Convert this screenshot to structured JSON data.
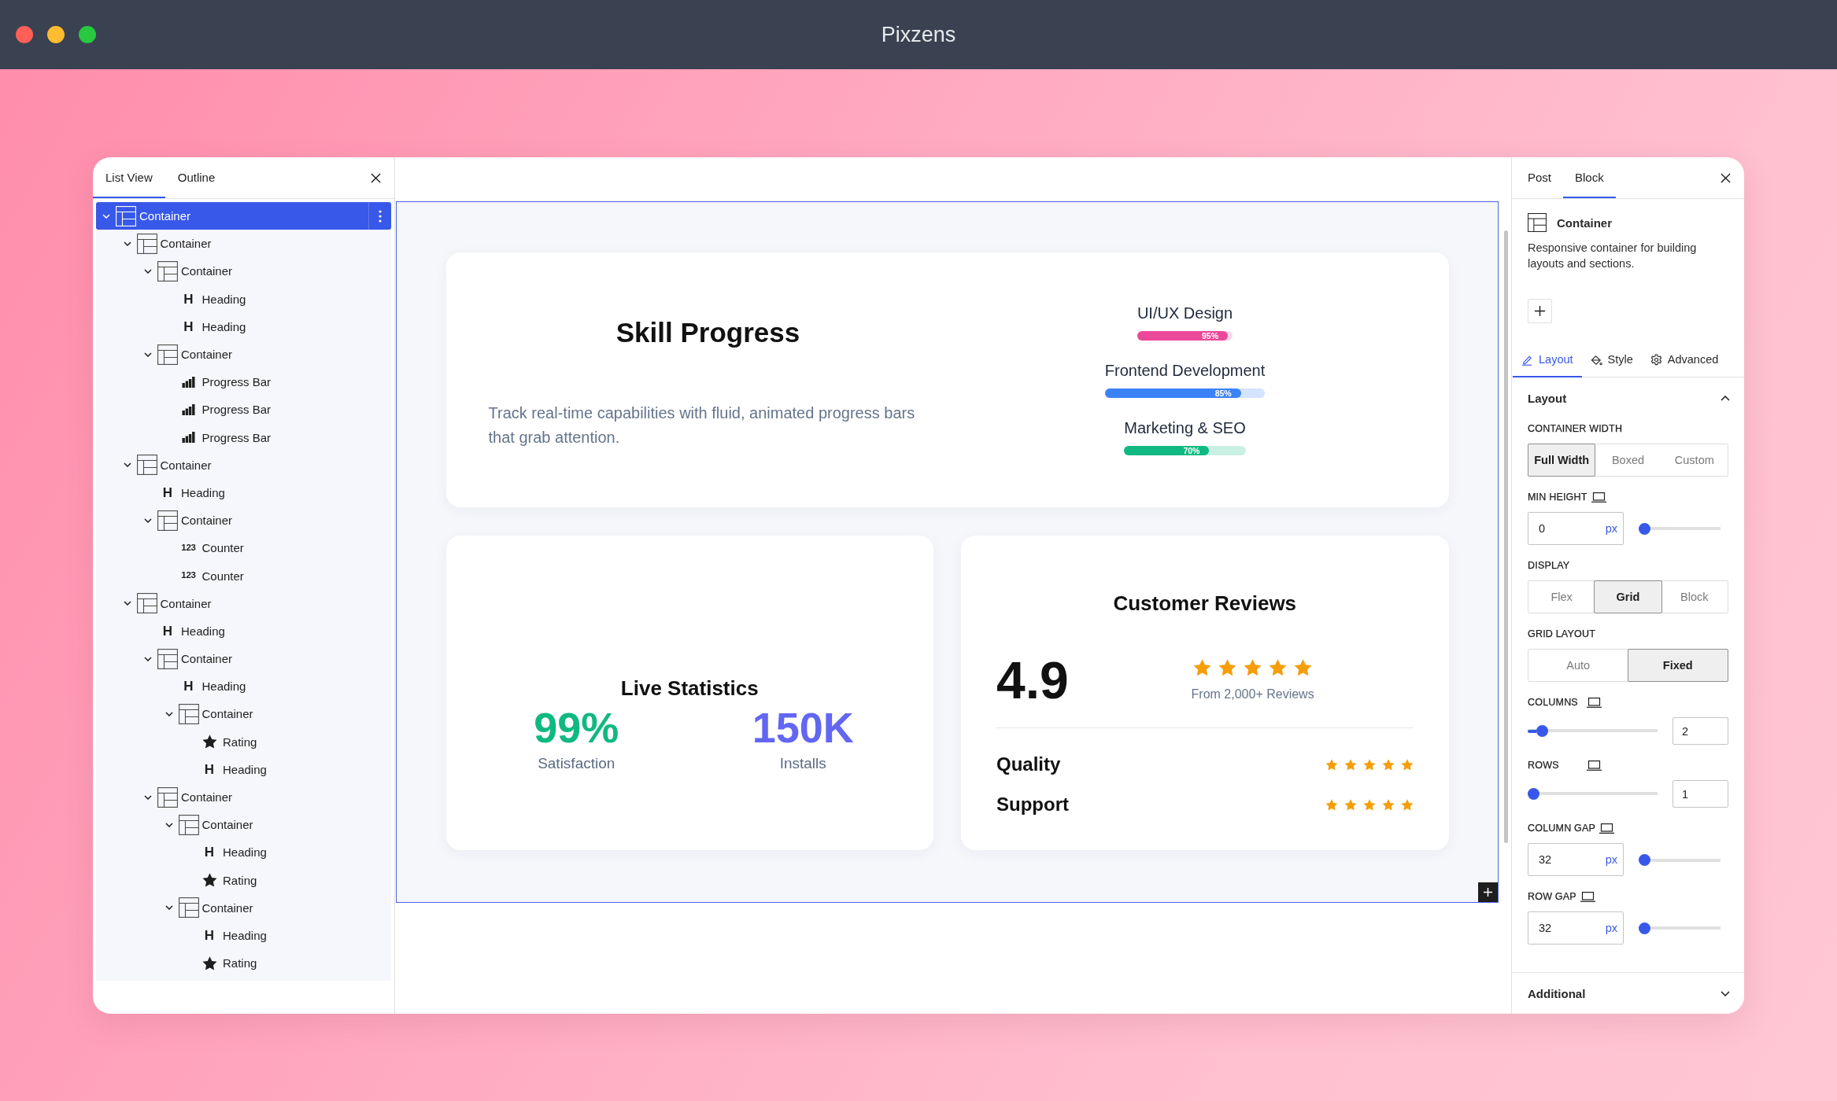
{
  "window": {
    "title": "Pixzens"
  },
  "list_panel": {
    "tabs": [
      {
        "label": "List View",
        "selected": true
      },
      {
        "label": "Outline",
        "selected": false
      }
    ],
    "tree": [
      {
        "kind": "container",
        "label": "Container",
        "selected": true,
        "expanded": true,
        "children": [
          {
            "kind": "container",
            "label": "Container",
            "selected": false,
            "expanded": true,
            "children": [
              {
                "kind": "container",
                "label": "Container",
                "selected": false,
                "expanded": true,
                "children": [
                  {
                    "kind": "heading",
                    "glyph": "H",
                    "label": "Heading",
                    "selected": false
                  },
                  {
                    "kind": "heading",
                    "glyph": "H",
                    "label": "Heading",
                    "selected": false
                  }
                ]
              },
              {
                "kind": "container",
                "label": "Container",
                "selected": false,
                "expanded": true,
                "children": [
                  {
                    "kind": "progress",
                    "label": "Progress Bar",
                    "selected": false
                  },
                  {
                    "kind": "progress",
                    "label": "Progress Bar",
                    "selected": false
                  },
                  {
                    "kind": "progress",
                    "label": "Progress Bar",
                    "selected": false
                  }
                ]
              }
            ]
          },
          {
            "kind": "container",
            "label": "Container",
            "selected": false,
            "expanded": true,
            "children": [
              {
                "kind": "heading",
                "glyph": "H",
                "label": "Heading",
                "selected": false
              },
              {
                "kind": "container",
                "label": "Container",
                "selected": false,
                "expanded": true,
                "children": [
                  {
                    "kind": "counter",
                    "glyph": "123",
                    "label": "Counter",
                    "selected": false
                  },
                  {
                    "kind": "counter",
                    "glyph": "123",
                    "label": "Counter",
                    "selected": false
                  }
                ]
              }
            ]
          },
          {
            "kind": "container",
            "label": "Container",
            "selected": false,
            "expanded": true,
            "children": [
              {
                "kind": "heading",
                "glyph": "H",
                "label": "Heading",
                "selected": false
              },
              {
                "kind": "container",
                "label": "Container",
                "selected": false,
                "expanded": true,
                "children": [
                  {
                    "kind": "heading",
                    "glyph": "H",
                    "label": "Heading",
                    "selected": false
                  },
                  {
                    "kind": "container",
                    "label": "Container",
                    "selected": false,
                    "expanded": true,
                    "children": [
                      {
                        "kind": "rating",
                        "label": "Rating",
                        "selected": false
                      },
                      {
                        "kind": "heading",
                        "glyph": "H",
                        "label": "Heading",
                        "selected": false
                      }
                    ]
                  }
                ]
              },
              {
                "kind": "container",
                "label": "Container",
                "selected": false,
                "expanded": true,
                "children": [
                  {
                    "kind": "container",
                    "label": "Container",
                    "selected": false,
                    "expanded": true,
                    "children": [
                      {
                        "kind": "heading",
                        "glyph": "H",
                        "label": "Heading",
                        "selected": false
                      },
                      {
                        "kind": "rating",
                        "label": "Rating",
                        "selected": false
                      }
                    ]
                  },
                  {
                    "kind": "container",
                    "label": "Container",
                    "selected": false,
                    "expanded": true,
                    "children": [
                      {
                        "kind": "heading",
                        "glyph": "H",
                        "label": "Heading",
                        "selected": false
                      },
                      {
                        "kind": "rating",
                        "label": "Rating",
                        "selected": false
                      }
                    ]
                  }
                ]
              }
            ]
          }
        ]
      }
    ]
  },
  "canvas": {
    "skill_card": {
      "title": "Skill Progress",
      "description": "Track real-time capabilities with fluid, animated progress bars that grab attention.",
      "skills": [
        {
          "label": "UI/UX Design",
          "level": 0.95,
          "percent": "95%",
          "color": "#ec4899"
        },
        {
          "label": "Frontend Development",
          "level": 0.85,
          "percent": "85%",
          "color": "#3b82f6"
        },
        {
          "label": "Marketing & SEO",
          "level": 0.7,
          "percent": "70%",
          "color": "#10b981"
        }
      ]
    },
    "stats_card": {
      "title": "Live Statistics",
      "stats": [
        {
          "value": "99%",
          "label": "Satisfaction",
          "color": "#10b981"
        },
        {
          "value": "150K",
          "label": "Installs",
          "color": "#6366f1"
        }
      ]
    },
    "reviews_card": {
      "title": "Customer Reviews",
      "score": "4.9",
      "stars": 5,
      "caption": "From 2,000+ Reviews",
      "rows": [
        {
          "label": "Quality",
          "stars": 5
        },
        {
          "label": "Support",
          "stars": 5
        }
      ]
    }
  },
  "settings_panel": {
    "tabs": [
      {
        "label": "Post",
        "selected": false
      },
      {
        "label": "Block",
        "selected": true
      }
    ],
    "block": {
      "name": "Container",
      "description": "Responsive container for building layouts and sections."
    },
    "sub_tabs": [
      {
        "kind": "pencil",
        "label": "Layout",
        "selected": true
      },
      {
        "kind": "paint",
        "label": "Style",
        "selected": false
      },
      {
        "kind": "gear",
        "label": "Advanced",
        "selected": false
      }
    ],
    "section": {
      "title": "Layout",
      "expanded": true
    },
    "controls": [
      {
        "kind": "segmented",
        "label": "CONTAINER WIDTH",
        "responsive": false,
        "options": [
          {
            "label": "Full Width",
            "selected": true
          },
          {
            "label": "Boxed",
            "selected": false
          },
          {
            "label": "Custom",
            "selected": false
          }
        ]
      },
      {
        "kind": "unit_slider",
        "label": "MIN HEIGHT",
        "responsive": true,
        "value": "0",
        "unit": "px",
        "level": 0
      },
      {
        "kind": "segmented",
        "label": "DISPLAY",
        "responsive": false,
        "options": [
          {
            "label": "Flex",
            "selected": false
          },
          {
            "label": "Grid",
            "selected": true
          },
          {
            "label": "Block",
            "selected": false
          }
        ]
      },
      {
        "kind": "segmented",
        "label": "GRID LAYOUT",
        "responsive": false,
        "options": [
          {
            "label": "Auto",
            "selected": false
          },
          {
            "label": "Fixed",
            "selected": true
          }
        ]
      },
      {
        "kind": "slider_number",
        "label": "COLUMNS",
        "responsive": true,
        "value": "2",
        "level": 0.07
      },
      {
        "kind": "slider_number",
        "label": "ROWS",
        "responsive": true,
        "value": "1",
        "level": 0
      },
      {
        "kind": "unit_slider",
        "label": "COLUMN GAP",
        "responsive": true,
        "value": "32",
        "unit": "px",
        "level": 0
      },
      {
        "kind": "unit_slider",
        "label": "ROW GAP",
        "responsive": true,
        "value": "32",
        "unit": "px",
        "level": 0
      }
    ],
    "additional": {
      "title": "Additional",
      "expanded": false
    }
  }
}
